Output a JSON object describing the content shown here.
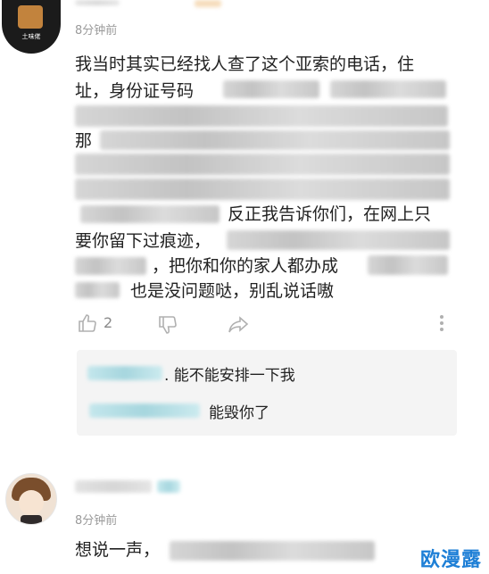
{
  "comment1": {
    "timestamp": "8分钟前",
    "avatar_text": "土味佬",
    "lines": [
      "我当时其实已经找人查了这个亚索的电话，住",
      "址，身份证号码",
      "那",
      "反正我告诉你们，在网上只",
      "要你留下过痕迹，",
      "，把你和你的家人都办成",
      "也是没问题哒，别乱说话嗷"
    ],
    "like_count": "2"
  },
  "replies": [
    {
      "text": ". 能不能安排一下我"
    },
    {
      "text": "能毁你了"
    }
  ],
  "comment2": {
    "timestamp": "8分钟前",
    "text": "想说一声，"
  },
  "watermark": "欧漫露"
}
